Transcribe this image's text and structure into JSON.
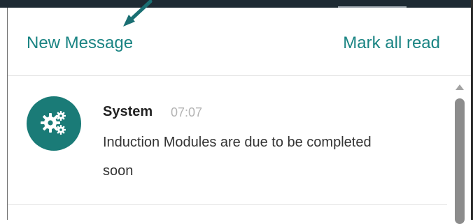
{
  "header": {
    "new_message": "New Message",
    "mark_all_read": "Mark all read"
  },
  "messages": [
    {
      "sender": "System",
      "time": "07:07",
      "text": "Induction Modules are due to be completed soon",
      "icon": "gears-icon"
    }
  ],
  "colors": {
    "accent": "#1a8483",
    "avatar_bg": "#1a7b77",
    "topbar": "#1e2a33",
    "arrow": "#1a6f73"
  }
}
